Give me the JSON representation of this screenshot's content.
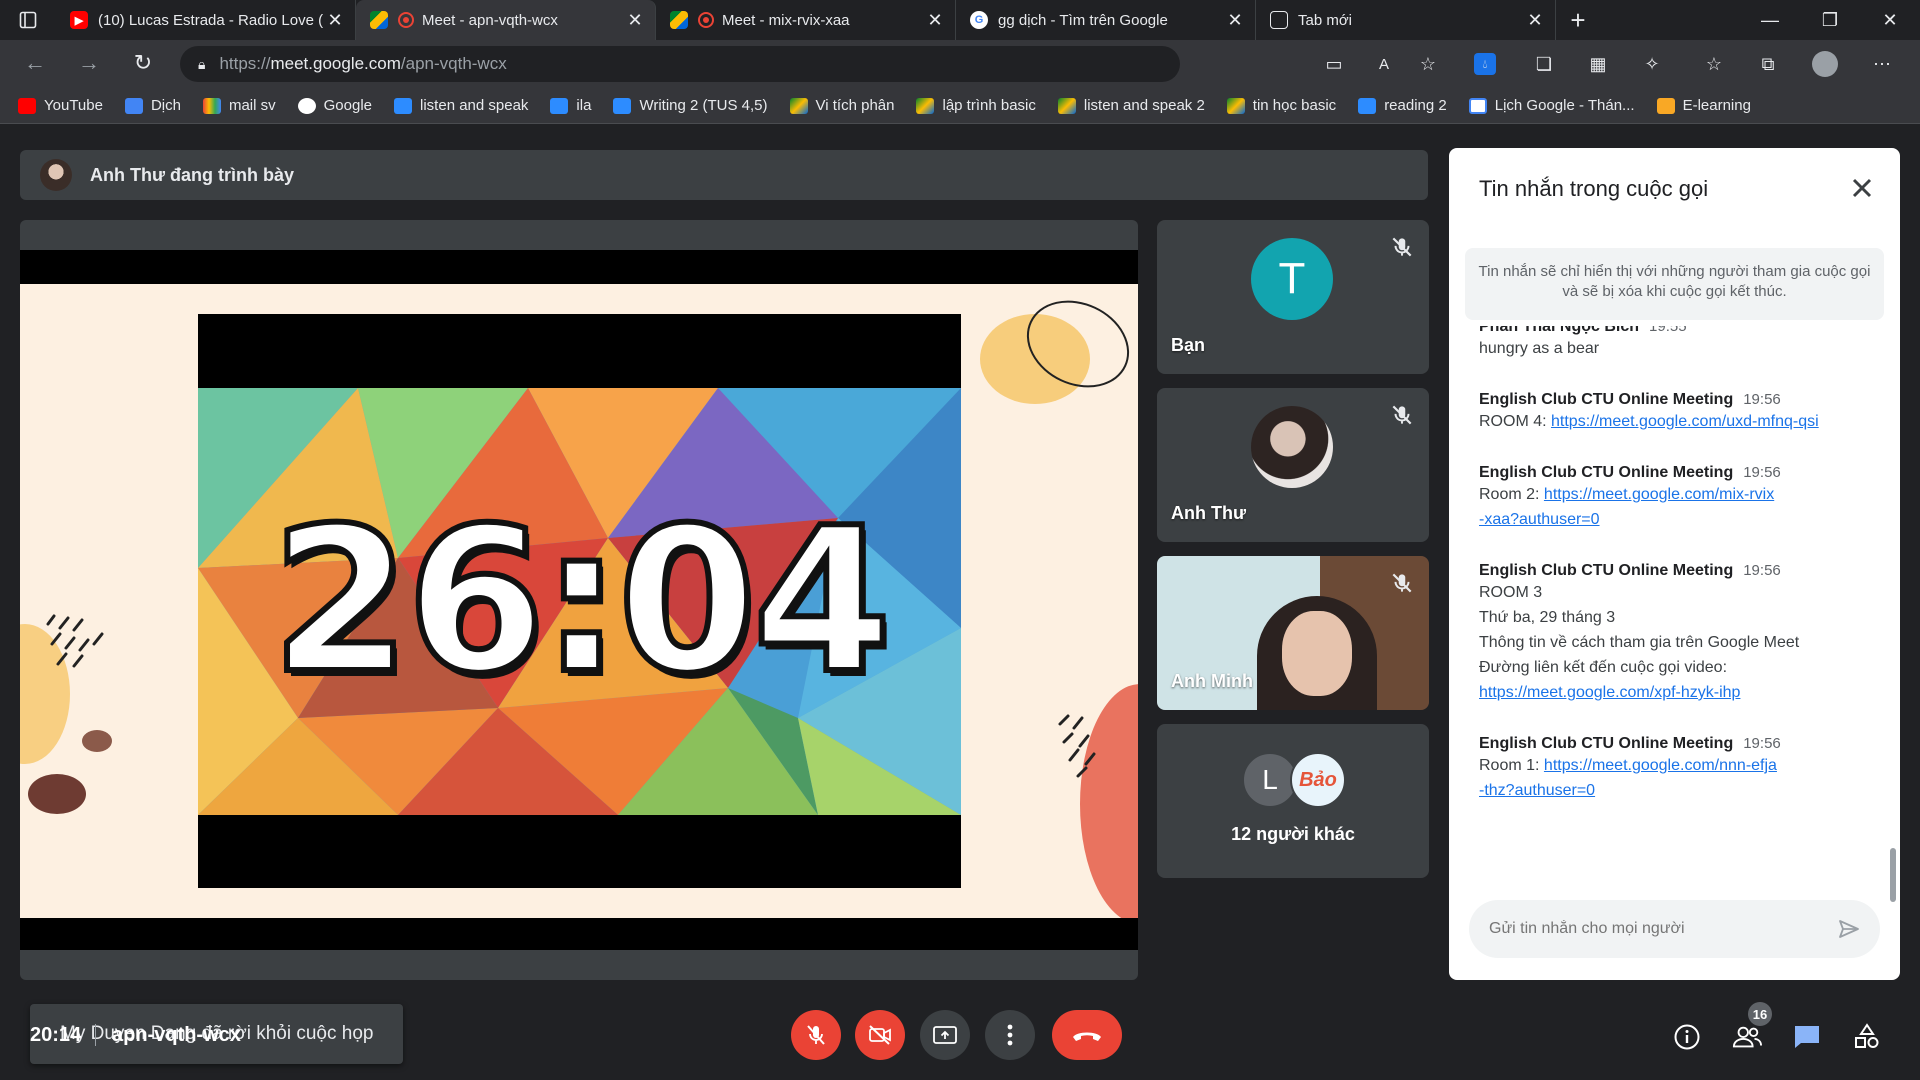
{
  "browser": {
    "tabs": [
      {
        "title": "(10) Lucas Estrada - Radio Love (",
        "icon": "youtube-icon",
        "active": false
      },
      {
        "title": "Meet - apn-vqth-wcx",
        "icon": "meet-icon",
        "active": true
      },
      {
        "title": "Meet - mix-rvix-xaa",
        "icon": "meet-icon",
        "active": false
      },
      {
        "title": "gg dịch - Tìm trên Google",
        "icon": "google-icon",
        "active": false
      },
      {
        "title": "Tab mới",
        "icon": "newtab-icon",
        "active": false
      }
    ],
    "url_scheme": "https://",
    "url_host": "meet.google.com",
    "url_path": "/apn-vqth-wcx",
    "bookmarks": [
      "YouTube",
      "Dịch",
      "mail sv",
      "Google",
      "listen and speak",
      "ila",
      "Writing 2 (TUS 4,5)",
      "Vi tích phân",
      "lập trình basic",
      "listen and speak 2",
      "tin học basic",
      "reading 2",
      "Lịch Google - Thán...",
      "E-learning"
    ]
  },
  "meet": {
    "presenting_text": "Anh Thư đang trình bày",
    "timer": "26:04",
    "toast": "My Duyen Dang đã rời khỏi cuộc họp",
    "participants": [
      {
        "name": "Bạn",
        "initial": "T",
        "color": "#12a4af"
      },
      {
        "name": "Anh Thư"
      },
      {
        "name": "Anh Minh"
      }
    ],
    "others": {
      "label": "12 người khác",
      "av1": "L",
      "av2": "Bảo"
    },
    "chat": {
      "title": "Tin nhắn trong cuộc gọi",
      "info": "Tin nhắn sẽ chỉ hiển thị với những người tham gia cuộc gọi và sẽ bị xóa khi cuộc gọi kết thúc.",
      "messages": [
        {
          "sender": "Phan Thái Ngọc Bích",
          "time": "19:55",
          "lines": [
            "hungry as a bear"
          ]
        },
        {
          "sender": "English Club CTU Online Meeting",
          "time": "19:56",
          "lines": [
            "ROOM 4: "
          ],
          "link": "https://meet.google.com/uxd-mfnq-qsi"
        },
        {
          "sender": "English Club CTU Online Meeting",
          "time": "19:56",
          "lines": [
            "Room 2: "
          ],
          "link": "https://meet.google.com/mix-rvix-xaa?authuser=0"
        },
        {
          "sender": "English Club CTU Online Meeting",
          "time": "19:56",
          "lines": [
            "ROOM 3",
            "Thứ ba, 29 tháng 3",
            "Thông tin về cách tham gia trên Google Meet",
            "Đường liên kết đến cuộc gọi video:"
          ],
          "link": "https://meet.google.com/xpf-hzyk-ihp"
        },
        {
          "sender": "English Club CTU Online Meeting",
          "time": "19:56",
          "lines": [
            "Room 1: "
          ],
          "link": "https://meet.google.com/nnn-efja-thz?authuser=0"
        }
      ],
      "input_placeholder": "Gửi tin nhắn cho mọi người"
    },
    "bottom": {
      "clock": "20:14",
      "code": "apn-vqth-wcx",
      "people_count": "16"
    }
  }
}
